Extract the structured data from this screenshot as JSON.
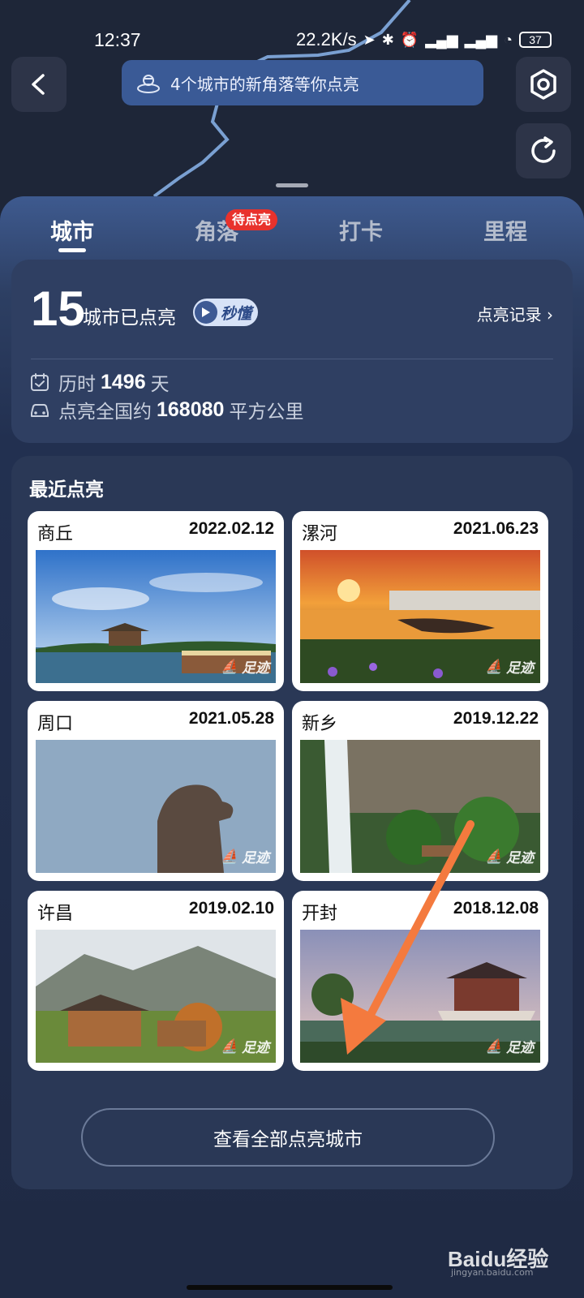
{
  "status_bar": {
    "time": "12:37",
    "network_speed": "22.2K/s",
    "icons": [
      "location-icon",
      "bluetooth-icon",
      "alarm-icon",
      "hd-signal-icon",
      "signal-icon",
      "hd-signal-icon",
      "signal-icon",
      "wifi-icon"
    ],
    "battery": "37"
  },
  "top_bar": {
    "back_icon": "chevron-left-icon",
    "banner_text": "4个城市的新角落等你点亮",
    "settings_icon": "settings-icon",
    "refresh_icon": "refresh-icon"
  },
  "tabs": [
    {
      "label": "城市",
      "active": true
    },
    {
      "label": "角落",
      "active": false,
      "badge": "待点亮"
    },
    {
      "label": "打卡",
      "active": false
    },
    {
      "label": "里程",
      "active": false
    }
  ],
  "summary": {
    "count": "15",
    "count_label": "城市已点亮",
    "video_tag": "秒懂",
    "record_link": "点亮记录 ›",
    "duration_prefix": "历时",
    "duration_value": "1496",
    "duration_unit": "天",
    "area_prefix": "点亮全国约",
    "area_value": "168080",
    "area_unit": "平方公里"
  },
  "recent": {
    "title": "最近点亮",
    "watermark": "足迹",
    "cities": [
      {
        "name": "商丘",
        "date": "2022.02.12"
      },
      {
        "name": "漯河",
        "date": "2021.06.23"
      },
      {
        "name": "周口",
        "date": "2021.05.28"
      },
      {
        "name": "新乡",
        "date": "2019.12.22"
      },
      {
        "name": "许昌",
        "date": "2019.02.10"
      },
      {
        "name": "开封",
        "date": "2018.12.08"
      }
    ],
    "view_all_label": "查看全部点亮城市"
  },
  "watermark_site": {
    "brand": "Baidu经验",
    "url": "jingyan.baidu.com"
  },
  "colors": {
    "accent": "#3a5a96",
    "badge": "#e8322c",
    "annotation_arrow": "#f47a3e"
  }
}
